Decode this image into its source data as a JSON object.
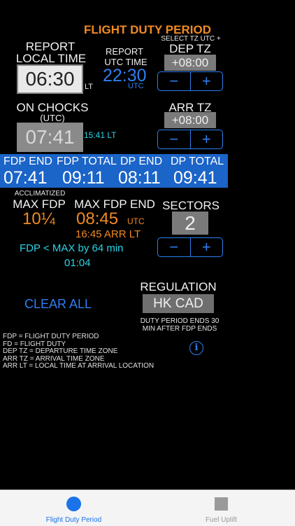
{
  "title": "FLIGHT DUTY PERIOD",
  "report": {
    "label_line1": "REPORT",
    "label_line2": "LOCAL TIME",
    "local_time": "06:30",
    "lt_suffix": "LT",
    "utc_label_line1": "REPORT",
    "utc_label_line2": "UTC TIME",
    "utc_time": "22:30",
    "utc_suffix": "UTC"
  },
  "dep_tz": {
    "hint": "SELECT TZ UTC +",
    "label": "DEP TZ",
    "value": "+08:00",
    "minus": "−",
    "plus": "+"
  },
  "on_chocks": {
    "label": "ON CHOCKS",
    "sublabel": "(UTC)",
    "time": "07:41",
    "local": "15:41 LT"
  },
  "arr_tz": {
    "label": "ARR TZ",
    "value": "+08:00",
    "minus": "−",
    "plus": "+"
  },
  "summary": {
    "fdp_end_label": "FDP END",
    "fdp_end": "07:41",
    "fdp_total_label": "FDP TOTAL",
    "fdp_total": "09:11",
    "dp_end_label": "DP END",
    "dp_end": "08:11",
    "dp_total_label": "DP TOTAL",
    "dp_total": "09:41"
  },
  "max_fdp": {
    "acclimatized": "ACCLIMATIZED",
    "label": "MAX FDP",
    "value": "10¼",
    "end_label": "MAX FDP END",
    "end_value": "08:45",
    "end_suffix": "UTC",
    "arr_lt": "16:45 ARR LT",
    "status": "FDP < MAX by 64 min",
    "status_time": "01:04"
  },
  "sectors": {
    "label": "SECTORS",
    "value": "2",
    "minus": "−",
    "plus": "+"
  },
  "clear_all": "CLEAR ALL",
  "regulation": {
    "label": "REGULATION",
    "value": "HK CAD",
    "note_line1": "DUTY PERIOD ENDS 30",
    "note_line2": "MIN AFTER FDP ENDS"
  },
  "legend": [
    "FDP = FLIGHT DUTY PERIOD",
    "FD = FLIGHT DUTY",
    "DEP TZ = DEPARTURE TIME ZONE",
    "ARR TZ = ARRIVAL TIME ZONE",
    "ARR LT = LOCAL TIME AT ARRIVAL LOCATION"
  ],
  "tabs": [
    {
      "label": "Flight Duty Period",
      "active": true,
      "icon": "circle-icon"
    },
    {
      "label": "Fuel Uplift",
      "active": false,
      "icon": "square-icon"
    }
  ],
  "colors": {
    "accent_orange": "#f08a24",
    "accent_blue": "#2f7ef0",
    "band_blue": "#1b64c8",
    "cyan": "#2ad4e6"
  }
}
